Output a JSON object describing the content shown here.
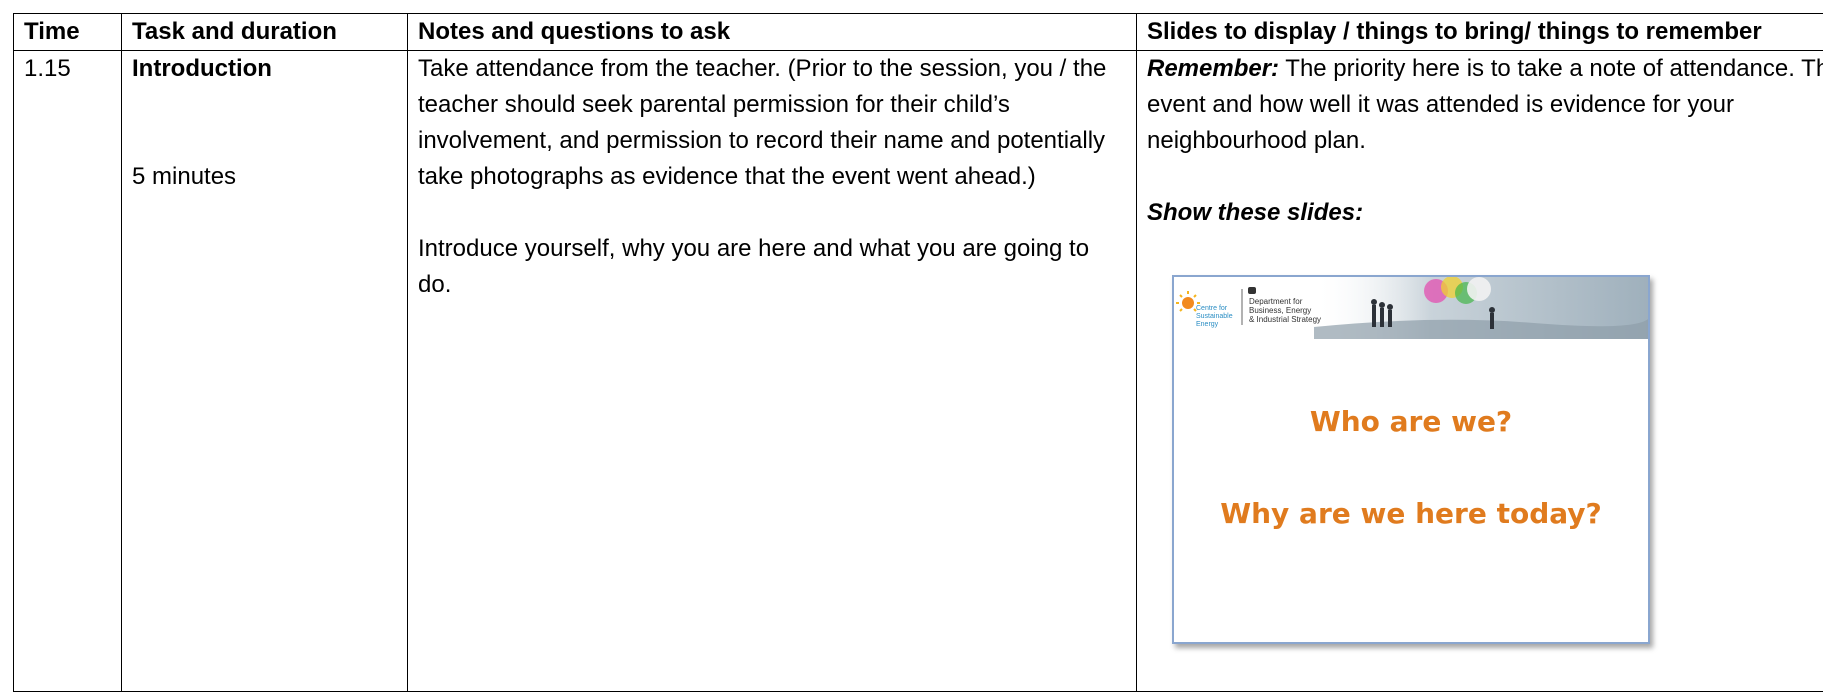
{
  "table": {
    "headers": {
      "time": "Time",
      "task": "Task and duration",
      "notes": "Notes and questions to ask",
      "slides": "Slides to display / things to bring/ things to remember"
    },
    "row": {
      "time": "1.15",
      "task_title": "Introduction",
      "task_duration": "5 minutes",
      "notes": [
        "Take attendance from the teacher. (Prior to the session, you / the teacher should seek parental permission for their child’s involvement, and permission to record their name and potentially take photographs as evidence that the event went ahead.)",
        "Introduce yourself, why you are here and what you are going to do."
      ],
      "slides": {
        "remember_label": "Remember:",
        "remember_text": " The priority here is to take a note of attendance. The event and how well it was attended is evidence for your neighbourhood plan.",
        "show_label": "Show these slides:"
      }
    }
  },
  "slide": {
    "logo_cse": [
      "Centre for",
      "Sustainable",
      "Energy"
    ],
    "logo_beis": [
      "Department for",
      "Business, Energy",
      "& Industrial Strategy"
    ],
    "line1": "Who are we?",
    "line2": "Why are we here today?",
    "title_color": "#e07b1e"
  }
}
